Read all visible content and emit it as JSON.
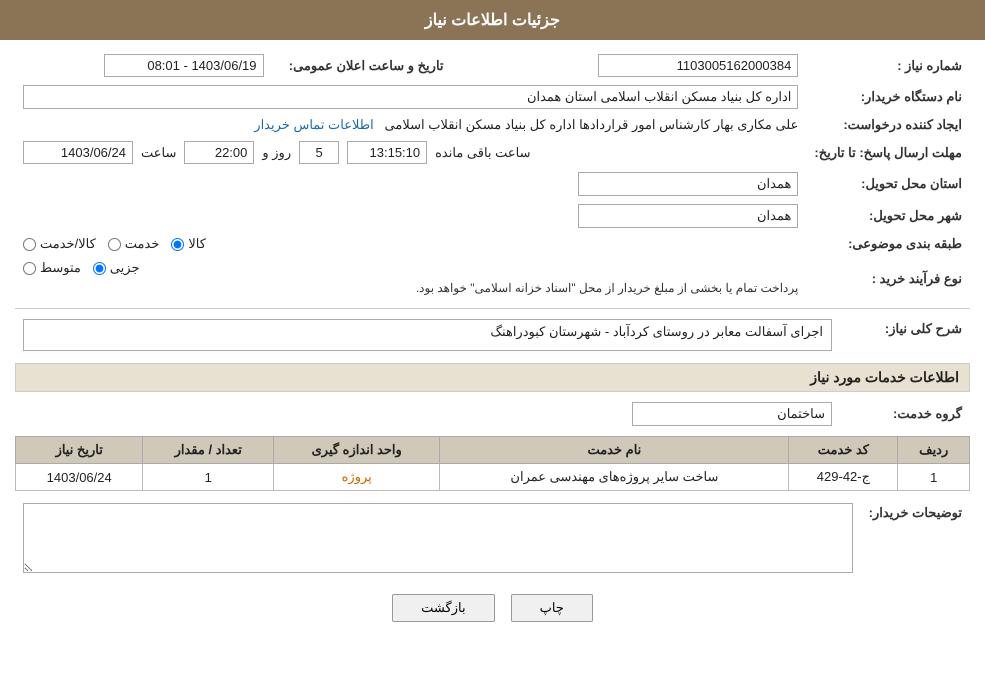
{
  "header": {
    "title": "جزئیات اطلاعات نیاز"
  },
  "fields": {
    "need_number_label": "شماره نیاز :",
    "need_number_value": "1103005162000384",
    "announcement_label": "تاریخ و ساعت اعلان عمومی:",
    "announcement_value": "1403/06/19 - 08:01",
    "buyer_name_label": "نام دستگاه خریدار:",
    "buyer_name_value": "اداره کل بنیاد مسکن انقلاب اسلامی استان همدان",
    "requester_label": "ایجاد کننده درخواست:",
    "requester_value": "علی مکاری بهار کارشناس امور قراردادها اداره کل بنیاد مسکن انقلاب اسلامی",
    "requester_link": "اطلاعات تماس خریدار",
    "deadline_label": "مهلت ارسال پاسخ: تا تاریخ:",
    "deadline_date": "1403/06/24",
    "deadline_time_label": "ساعت",
    "deadline_time": "22:00",
    "deadline_days_label": "روز و",
    "deadline_days": "5",
    "deadline_remain_label": "ساعت باقی مانده",
    "deadline_remain": "13:15:10",
    "province_label": "استان محل تحویل:",
    "province_value": "همدان",
    "city_label": "شهر محل تحویل:",
    "city_value": "همدان",
    "category_label": "طبقه بندی موضوعی:",
    "category_kala": "کالا",
    "category_khadamat": "خدمت",
    "category_kala_khadamat": "کالا/خدمت",
    "purchase_type_label": "نوع فرآیند خرید :",
    "purchase_jozei": "جزیی",
    "purchase_motavasset": "متوسط",
    "purchase_note": "پرداخت تمام یا بخشی از مبلغ خریدار از محل \"اسناد خزانه اسلامی\" خواهد بود.",
    "need_description_label": "شرح کلی نیاز:",
    "need_description_value": "اجرای آسفالت معابر در روستای کردآباد - شهرستان کبودراهنگ",
    "services_section_label": "اطلاعات خدمات مورد نیاز",
    "service_group_label": "گروه خدمت:",
    "service_group_value": "ساختمان",
    "table_headers": [
      "ردیف",
      "کد خدمت",
      "نام خدمت",
      "واحد اندازه گیری",
      "تعداد / مقدار",
      "تاریخ نیاز"
    ],
    "table_rows": [
      {
        "row": "1",
        "code": "ج-42-429",
        "name": "ساخت سایر پروژه‌های مهندسی عمران",
        "unit": "پروژه",
        "quantity": "1",
        "date": "1403/06/24"
      }
    ],
    "buyer_desc_label": "توضیحات خریدار:",
    "buyer_desc_value": "",
    "btn_back": "بازگشت",
    "btn_print": "چاپ"
  }
}
